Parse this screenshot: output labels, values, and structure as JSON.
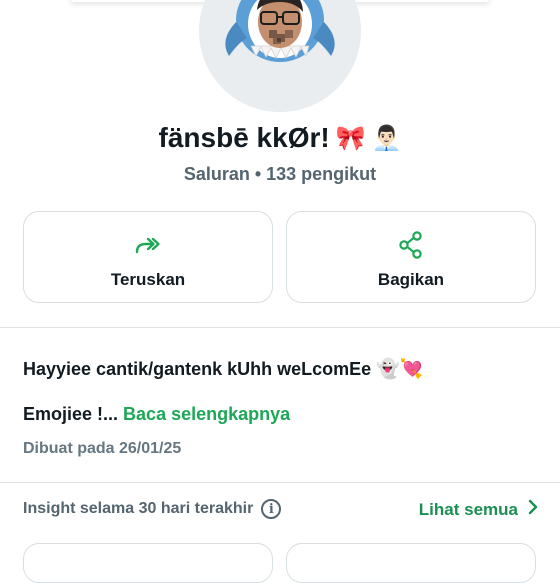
{
  "channel": {
    "name": "fänsbē kkØr!",
    "name_emoji_1": "🎀",
    "name_emoji_2": "👨🏻‍💼",
    "meta": "Saluran • 133 pengikut"
  },
  "actions": {
    "forward_label": "Teruskan",
    "share_label": "Bagikan"
  },
  "description": {
    "line1": "Hayyiee cantik/gantenk kUhh weLcomEe",
    "line1_emoji": "👻💘",
    "line2": "Emojiee !...",
    "read_more": "Baca selengkapnya",
    "created": "Dibuat pada 26/01/25"
  },
  "insight": {
    "label": "Insight selama 30 hari terakhir",
    "info_icon": "i",
    "see_all": "Lihat semua"
  },
  "colors": {
    "accent_green": "#1da858",
    "text_primary": "#111b21",
    "text_secondary": "#54656f"
  },
  "icons": {
    "forward": "double-forward-arrow-icon",
    "share": "share-icon",
    "info": "info-icon",
    "chevron": "chevron-right-icon"
  }
}
